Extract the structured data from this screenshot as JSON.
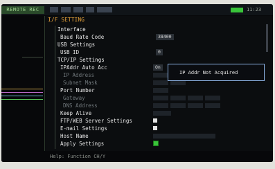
{
  "status_bar": {
    "left_label": "REMOTE REC",
    "clock": "11:23",
    "icons": [
      "channel-icon",
      "trigger-icon",
      "timebase-icon",
      "memory-icon",
      "battery-icon"
    ]
  },
  "panel": {
    "title": "I/F SETTING",
    "rows": [
      {
        "label": "Interface",
        "kind": "head"
      },
      {
        "label": "Baud Rate Code",
        "value": "38400"
      },
      {
        "label": "USB Settings",
        "kind": "head"
      },
      {
        "label": "USB ID",
        "value": "0"
      },
      {
        "label": "TCP/IP Settings",
        "kind": "head"
      },
      {
        "label": "IPAddr Auto Acc",
        "value": "On"
      },
      {
        "label": "IP Address",
        "kind": "dim"
      },
      {
        "label": "Subnet Mask",
        "kind": "dim"
      },
      {
        "label": "Port Number",
        "value": ""
      },
      {
        "label": "Gateway",
        "kind": "dim"
      },
      {
        "label": "DNS Address",
        "kind": "dim"
      },
      {
        "label": "Keep Alive",
        "value": ""
      },
      {
        "label": "FTP/WEB Server Settings",
        "value": ""
      },
      {
        "label": "E-mail Settings",
        "value": ""
      },
      {
        "label": "Host Name",
        "value": ""
      },
      {
        "label": "Apply Settings",
        "value": ""
      }
    ],
    "tooltip": "IP Addr Not Acquired"
  },
  "footer": {
    "text": "Help: Function CH/Y"
  },
  "colors": {
    "accent": "#e8a33a",
    "status_green": "#39c43a",
    "highlight_border": "#8fb6e8"
  }
}
